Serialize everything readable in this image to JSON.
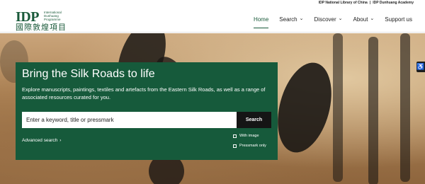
{
  "top_links": {
    "lib": "IDP National Library of China",
    "sep": "|",
    "academy": "IDP Dunhuang Academy"
  },
  "logo": {
    "big": "IDP",
    "small": "International Dunhuang Programme",
    "chinese": "國際敦煌項目"
  },
  "nav": [
    {
      "label": "Home",
      "has_dropdown": false,
      "active": true
    },
    {
      "label": "Search",
      "has_dropdown": true
    },
    {
      "label": "Discover",
      "has_dropdown": true
    },
    {
      "label": "About",
      "has_dropdown": true
    },
    {
      "label": "Support us",
      "has_dropdown": false
    }
  ],
  "hero": {
    "title": "Bring the Silk Roads to life",
    "description": "Explore manuscripts, paintings, textiles and artefacts from the Eastern Silk Roads, as well as a range of associated resources curated for you.",
    "search_placeholder": "Enter a keyword, title or pressmark",
    "search_button": "Search",
    "advanced_search": "Advanced search",
    "checkbox_with_image": "With image",
    "checkbox_pressmark_only": "Pressmark only"
  },
  "icons": {
    "chevron": "chevron-down-icon",
    "arrow": "chevron-right-icon",
    "accessibility": "accessibility-icon"
  },
  "colors": {
    "brand_green": "#165a3b",
    "button_black": "#151515"
  }
}
